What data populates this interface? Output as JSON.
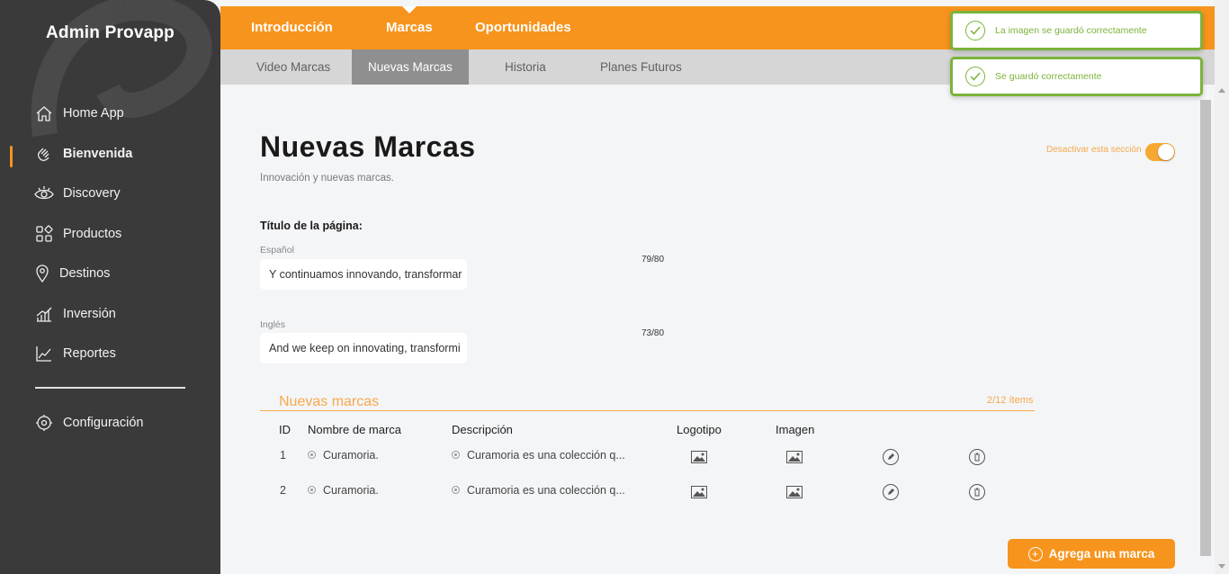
{
  "app": {
    "brand": "Admin Provapp"
  },
  "sidebar": {
    "items": [
      {
        "label": "Home App",
        "icon": "home-icon"
      },
      {
        "label": "Bienvenida",
        "icon": "waving-hand-icon",
        "active": true
      },
      {
        "label": "Discovery",
        "icon": "eye-icon"
      },
      {
        "label": "Productos",
        "icon": "grid-icon"
      },
      {
        "label": "Destinos",
        "icon": "location-pin-icon"
      },
      {
        "label": "Inversión",
        "icon": "bar-growth-icon"
      },
      {
        "label": "Reportes",
        "icon": "line-chart-icon"
      }
    ],
    "settings": {
      "label": "Configuración",
      "icon": "gear-icon"
    }
  },
  "top_tabs": [
    {
      "label": "Introducción"
    },
    {
      "label": "Marcas",
      "active": true
    },
    {
      "label": "Oportunidades"
    }
  ],
  "sub_tabs": [
    {
      "label": "Video Marcas"
    },
    {
      "label": "Nuevas Marcas",
      "active": true
    },
    {
      "label": "Historia"
    },
    {
      "label": "Planes Futuros"
    }
  ],
  "page": {
    "title": "Nuevas Marcas",
    "subtitle": "Innovación y nuevas marcas.",
    "toggle_label": "Desactivar esta sección",
    "toggle_on": true
  },
  "form": {
    "section_label": "Título de la página:",
    "spanish": {
      "label": "Español",
      "value": "Y continuamos innovando, transformar",
      "counter": "79/80"
    },
    "english": {
      "label": "Inglés",
      "value": "And we keep on innovating, transformi",
      "counter": "73/80"
    }
  },
  "brands_list": {
    "title": "Nuevas marcas",
    "count": "2/12 ítems",
    "headers": {
      "id": "ID",
      "name": "Nombre de marca",
      "description": "Descripción",
      "logo": "Logotipo",
      "image": "Imagen"
    },
    "rows": [
      {
        "id": "1",
        "name": "Curamoria.",
        "description": "Curamoria es una colección q..."
      },
      {
        "id": "2",
        "name": "Curamoria.",
        "description": "Curamoria es una colección q..."
      }
    ]
  },
  "toasts": [
    {
      "message": "La imagen se guardó correctamente"
    },
    {
      "message": "Se guardó correctamente"
    }
  ],
  "actions": {
    "add_brand": "Agrega una marca"
  },
  "colors": {
    "accent": "#f7941d",
    "sidebar": "#3a3a3a",
    "success": "#7bb33a"
  }
}
